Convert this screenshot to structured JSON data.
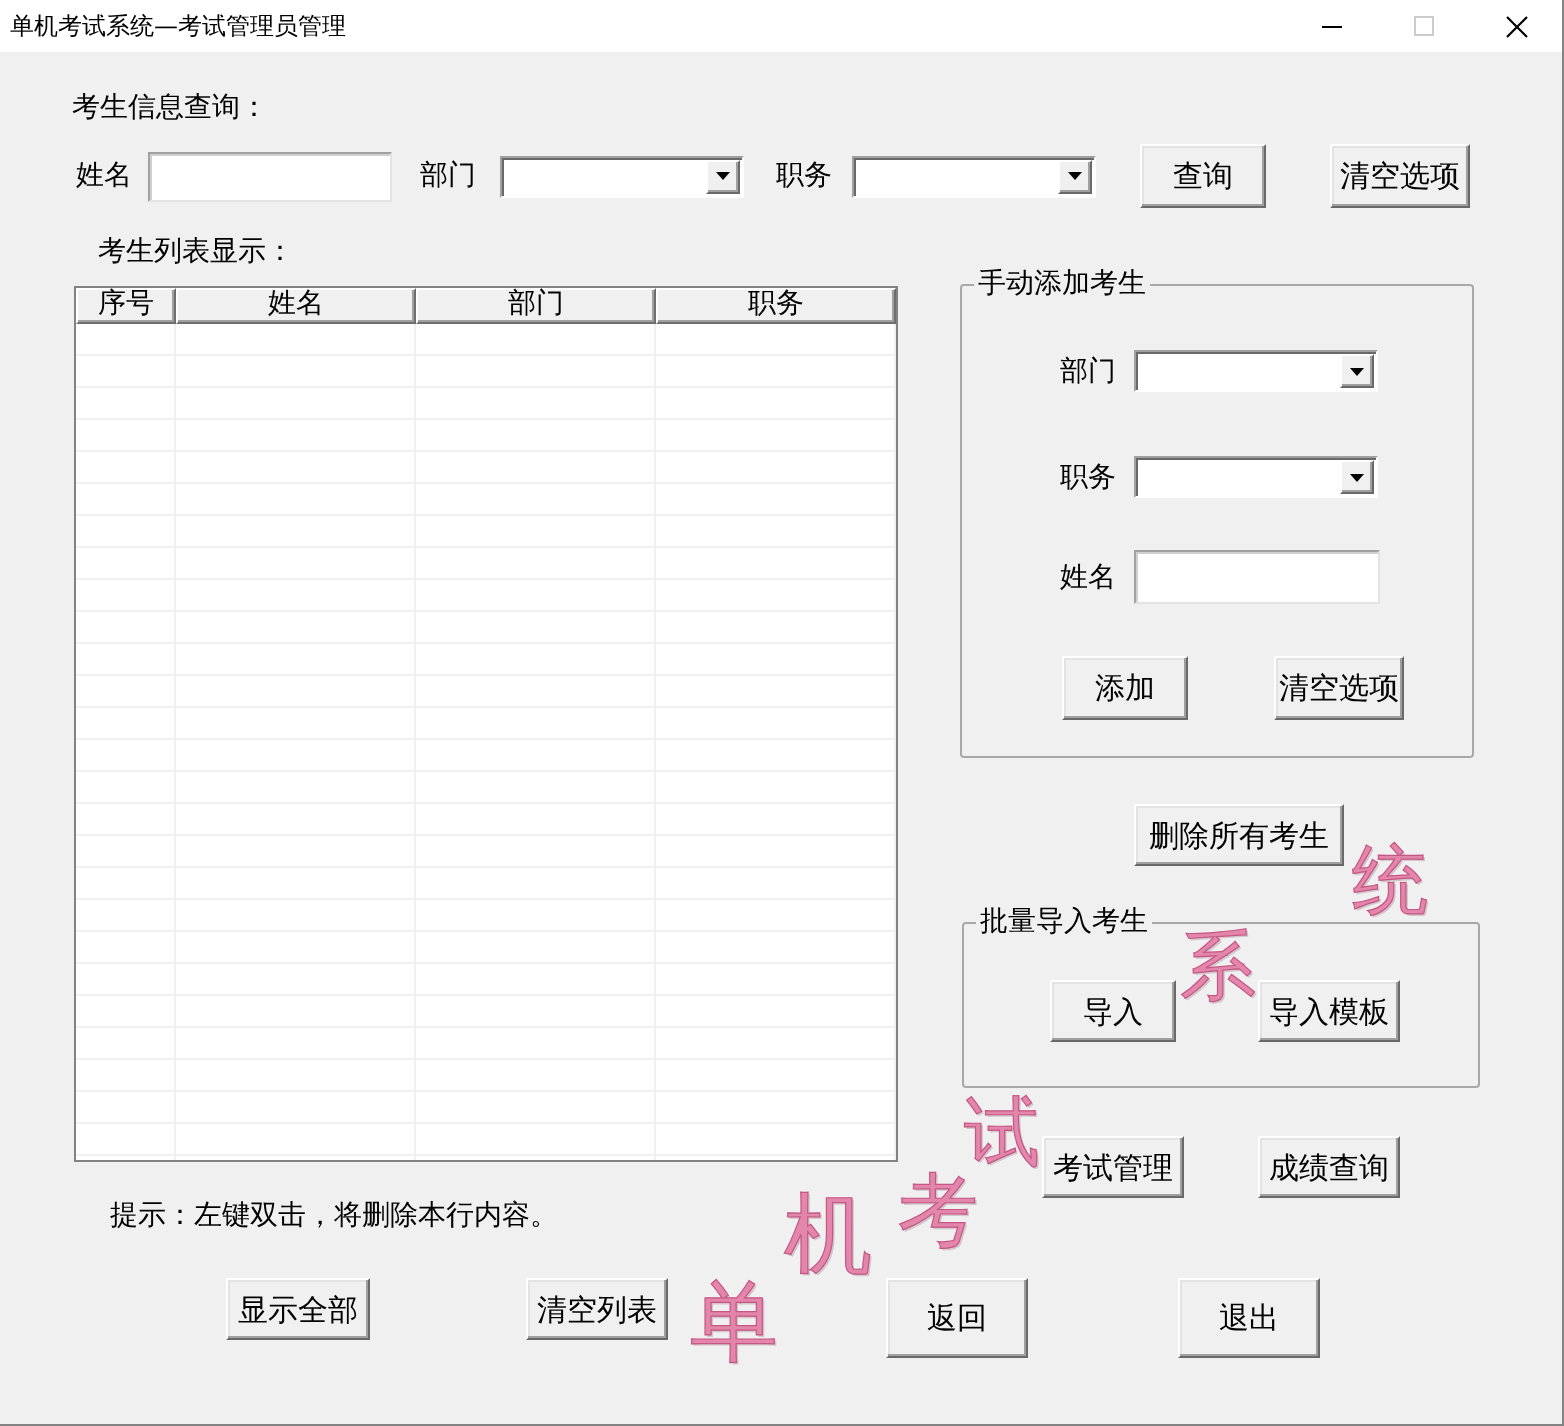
{
  "window": {
    "title": "单机考试系统—考试管理员管理",
    "maximize_enabled": false
  },
  "search": {
    "heading": "考生信息查询：",
    "fields": [
      {
        "label": "姓名",
        "kind": "text"
      },
      {
        "label": "部门",
        "kind": "combo"
      },
      {
        "label": "职务",
        "kind": "combo"
      }
    ],
    "buttons": [
      "查询",
      "清空选项"
    ]
  },
  "student_list": {
    "heading": "考生列表显示：",
    "columns": [
      "序号",
      "姓名",
      "部门",
      "职务"
    ],
    "hint": "提示：左键双击，将删除本行内容。"
  },
  "manual_add": {
    "title": "手动添加考生",
    "fields": [
      {
        "label": "部门",
        "kind": "combo"
      },
      {
        "label": "职务",
        "kind": "combo"
      },
      {
        "label": "姓名",
        "kind": "text"
      }
    ],
    "buttons": [
      "添加",
      "清空选项"
    ]
  },
  "delete_all_button": "删除所有考生",
  "batch_import": {
    "title": "批量导入考生",
    "buttons": [
      "导入",
      "导入模板"
    ]
  },
  "nav_buttons": [
    "考试管理",
    "成绩查询"
  ],
  "list_buttons": [
    "显示全部",
    "清空列表"
  ],
  "footer_buttons": [
    "返回",
    "退出"
  ],
  "background_art": {
    "text": "单机考试系统"
  }
}
